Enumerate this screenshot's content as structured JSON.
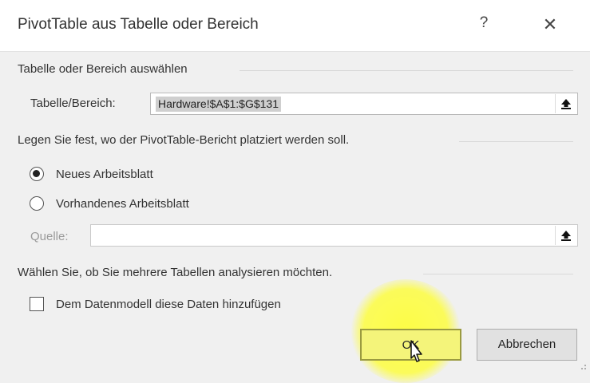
{
  "dialog": {
    "title": "PivotTable aus Tabelle oder Bereich",
    "help_label": "?",
    "close_label": "✕"
  },
  "select_section": {
    "heading": "Tabelle oder Bereich auswählen",
    "range_label": "Tabelle/Bereich:",
    "range_value": "Hardware!$A$1:$G$131"
  },
  "placement_section": {
    "heading": "Legen Sie fest, wo der PivotTable-Bericht platziert werden soll.",
    "option_new": "Neues Arbeitsblatt",
    "option_existing": "Vorhandenes Arbeitsblatt",
    "selected": "new",
    "source_label": "Quelle:",
    "source_value": ""
  },
  "analyze_section": {
    "heading": "Wählen Sie, ob Sie mehrere Tabellen analysieren möchten.",
    "datamodel_label": "Dem Datenmodell diese Daten hinzufügen",
    "datamodel_checked": false
  },
  "buttons": {
    "ok_label": "OK",
    "cancel_label": "Abbrechen"
  },
  "icons": {
    "collapse": "collapse-dialog-icon",
    "cursor": "mouse-pointer-icon"
  },
  "colors": {
    "highlight": "#ffff28",
    "dialog_bg": "#f0f0f0"
  }
}
